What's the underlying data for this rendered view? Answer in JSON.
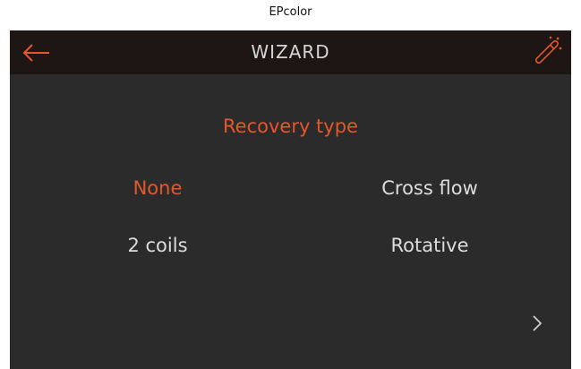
{
  "caption": "EPcolor",
  "header": {
    "title": "WIZARD",
    "back_icon": "back-arrow-icon",
    "wizard_icon": "magic-wand-icon"
  },
  "section": {
    "title": "Recovery type"
  },
  "options": [
    {
      "label": "None",
      "selected": true
    },
    {
      "label": "Cross flow",
      "selected": false
    },
    {
      "label": "2 coils",
      "selected": false
    },
    {
      "label": "Rotative",
      "selected": false
    }
  ],
  "footer": {
    "next_icon": "chevron-right-icon"
  },
  "colors": {
    "accent": "#e2582a",
    "background": "#2b2b2b",
    "header_background": "#1e1614",
    "text": "#dcdcdc"
  }
}
